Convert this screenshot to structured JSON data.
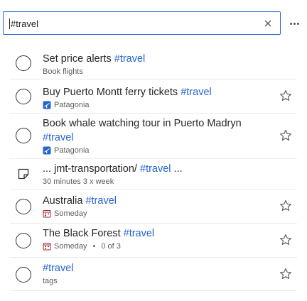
{
  "search": {
    "value": "#travel"
  },
  "tasks": [
    {
      "title": "Set price alerts ",
      "tag": "#travel",
      "meta": "Book flights"
    },
    {
      "title": "Buy Puerto Montt ferry tickets ",
      "tag": "#travel",
      "meta": "Patagonia"
    },
    {
      "title": "Book whale watching tour in Puerto Madryn ",
      "tag": "#travel",
      "meta": "Patagonia"
    },
    {
      "title": "... jmt-transportation/ ",
      "tag": "#travel",
      "title_suffix": " ...",
      "meta": "30 minutes 3 x week"
    },
    {
      "title": "Australia ",
      "tag": "#travel",
      "meta": "Someday"
    },
    {
      "title": "The Black Forest ",
      "tag": "#travel",
      "meta": "Someday",
      "meta2": "0 of 3"
    },
    {
      "title": "",
      "tag": "#travel",
      "meta": "tags"
    }
  ],
  "separator": "•",
  "colors": {
    "accent": "#2564cf",
    "text": "#262626",
    "secondary": "#605e5c",
    "border": "#edebe9"
  }
}
